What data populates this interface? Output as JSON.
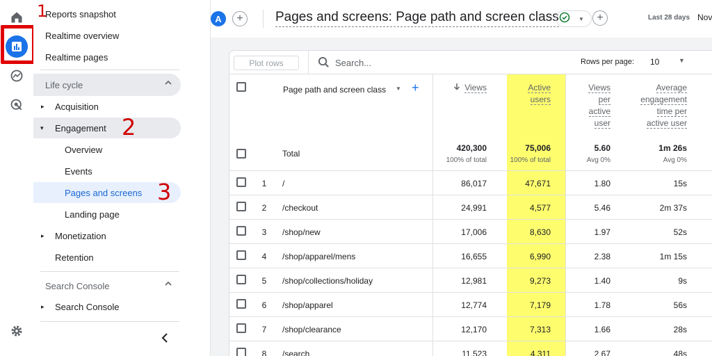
{
  "annotations": {
    "step1": "1",
    "step2": "2",
    "step3": "3"
  },
  "rail_icons": [
    "home-icon",
    "reports-icon",
    "explore-icon",
    "advertising-icon",
    "settings-icon"
  ],
  "sidebar": {
    "top_items": [
      "Reports snapshot",
      "Realtime overview",
      "Realtime pages"
    ],
    "lifecycle_label": "Life cycle",
    "acquisition": "Acquisition",
    "engagement": "Engagement",
    "engagement_children": [
      "Overview",
      "Events",
      "Pages and screens",
      "Landing page"
    ],
    "monetization": "Monetization",
    "retention": "Retention",
    "search_console_label": "Search Console",
    "search_console_item": "Search Console"
  },
  "header": {
    "avatar_letter": "A",
    "title": "Pages and screens: Page path and screen class",
    "date_range_label": "Last 28 days",
    "date_value": "Nov"
  },
  "toolbar": {
    "plot_rows_label": "Plot rows",
    "search_placeholder": "Search...",
    "rows_per_page_label": "Rows per page:",
    "rows_per_page_value": "10"
  },
  "table": {
    "dimension_header": "Page path and screen class",
    "columns": {
      "views": "Views",
      "active_users_1": "Active",
      "active_users_2": "users",
      "vpu_1": "Views",
      "vpu_2": "per",
      "vpu_3": "active",
      "vpu_4": "user",
      "aet_1": "Average",
      "aet_2": "engagement",
      "aet_3": "time per",
      "aet_4": "active user"
    },
    "total": {
      "label": "Total",
      "views": "420,300",
      "views_sub": "100% of total",
      "active_users": "75,006",
      "active_users_sub": "100% of total",
      "vpu": "5.60",
      "vpu_sub": "Avg 0%",
      "aet": "1m 26s",
      "aet_sub": "Avg 0%"
    },
    "rows": [
      {
        "idx": "1",
        "path": "/",
        "views": "86,017",
        "users": "47,671",
        "vpu": "1.80",
        "aet": "15s"
      },
      {
        "idx": "2",
        "path": "/checkout",
        "views": "24,991",
        "users": "4,577",
        "vpu": "5.46",
        "aet": "2m 37s"
      },
      {
        "idx": "3",
        "path": "/shop/new",
        "views": "17,006",
        "users": "8,630",
        "vpu": "1.97",
        "aet": "52s"
      },
      {
        "idx": "4",
        "path": "/shop/apparel/mens",
        "views": "16,655",
        "users": "6,990",
        "vpu": "2.38",
        "aet": "1m 15s"
      },
      {
        "idx": "5",
        "path": "/shop/collections/holiday",
        "views": "12,981",
        "users": "9,273",
        "vpu": "1.40",
        "aet": "9s"
      },
      {
        "idx": "6",
        "path": "/shop/apparel",
        "views": "12,774",
        "users": "7,179",
        "vpu": "1.78",
        "aet": "56s"
      },
      {
        "idx": "7",
        "path": "/shop/clearance",
        "views": "12,170",
        "users": "7,313",
        "vpu": "1.66",
        "aet": "28s"
      },
      {
        "idx": "8",
        "path": "/search",
        "views": "11,523",
        "users": "4,311",
        "vpu": "2.67",
        "aet": "48s"
      }
    ]
  },
  "colors": {
    "accent": "#1a73e8",
    "highlight": "#fdfd6e",
    "annotation_red": "#e00000",
    "selected_nav_bg": "#e8f0fe"
  }
}
